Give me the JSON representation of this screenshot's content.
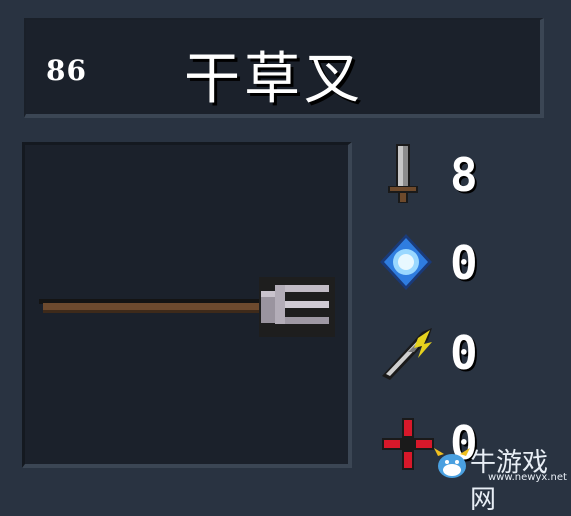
{
  "item": {
    "id": "86",
    "name": "干草叉",
    "icon": "pitchfork-icon"
  },
  "stats": [
    {
      "name": "attack",
      "icon": "sword-icon",
      "value": "8"
    },
    {
      "name": "mana",
      "icon": "blue-gem-icon",
      "value": "0"
    },
    {
      "name": "critical",
      "icon": "lightning-blade-icon",
      "value": "0"
    },
    {
      "name": "accuracy",
      "icon": "red-crosshair-icon",
      "value": "0"
    }
  ],
  "watermark": {
    "text": "牛游戏网",
    "url": "www.newyx.net"
  },
  "colors": {
    "background": "#293341",
    "panel": "#1b212b",
    "text": "#ffffff"
  }
}
